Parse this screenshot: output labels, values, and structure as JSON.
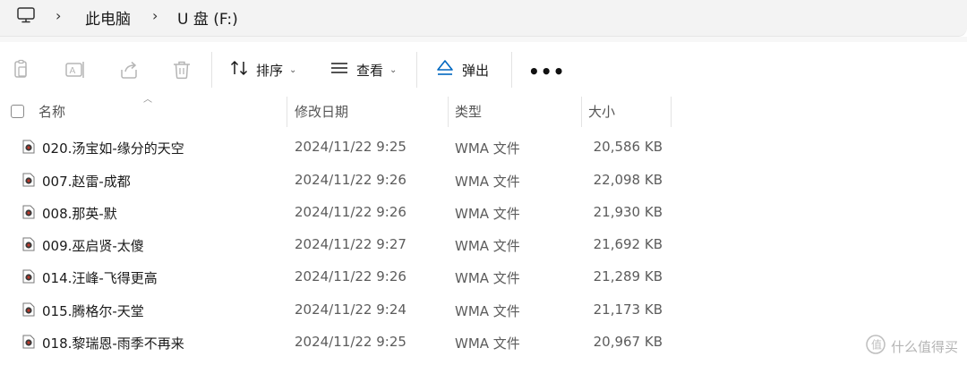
{
  "address_bar": {
    "crumbs": [
      "此电脑",
      "U 盘 (F:)"
    ]
  },
  "toolbar": {
    "icons": [
      "copy-icon",
      "rename-icon",
      "share-icon",
      "delete-icon"
    ],
    "sort_label": "排序",
    "view_label": "查看",
    "eject_label": "弹出",
    "more_label": "•••"
  },
  "columns": {
    "name": "名称",
    "date": "修改日期",
    "type": "类型",
    "size": "大小"
  },
  "files": [
    {
      "name": "020.汤宝如-缘分的天空",
      "date": "2024/11/22 9:25",
      "type": "WMA 文件",
      "size": "20,586 KB"
    },
    {
      "name": "007.赵雷-成都",
      "date": "2024/11/22 9:26",
      "type": "WMA 文件",
      "size": "22,098 KB"
    },
    {
      "name": "008.那英-默",
      "date": "2024/11/22 9:26",
      "type": "WMA 文件",
      "size": "21,930 KB"
    },
    {
      "name": "009.巫启贤-太傻",
      "date": "2024/11/22 9:27",
      "type": "WMA 文件",
      "size": "21,692 KB"
    },
    {
      "name": "014.汪峰-飞得更高",
      "date": "2024/11/22 9:26",
      "type": "WMA 文件",
      "size": "21,289 KB"
    },
    {
      "name": "015.腾格尔-天堂",
      "date": "2024/11/22 9:24",
      "type": "WMA 文件",
      "size": "21,173 KB"
    },
    {
      "name": "018.黎瑞恩-雨季不再来",
      "date": "2024/11/22 9:25",
      "type": "WMA 文件",
      "size": "20,967 KB"
    }
  ],
  "watermark": {
    "text": "什么值得买"
  },
  "colors": {
    "accent": "#0067c0",
    "text": "#1a1a1a",
    "muted": "#5c5c5c"
  }
}
